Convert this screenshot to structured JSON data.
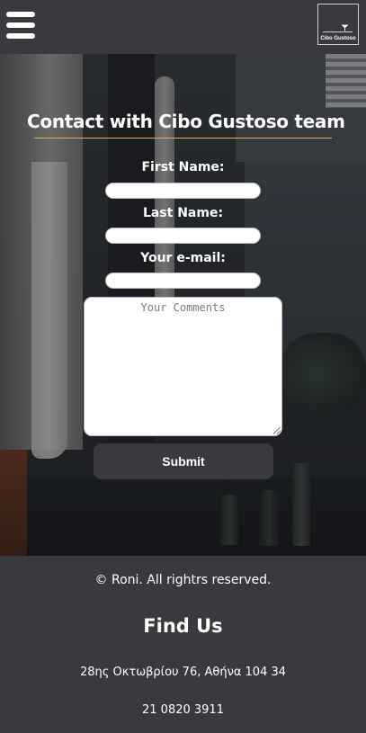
{
  "header": {
    "menu_icon": "hamburger-menu-icon",
    "logo": {
      "text": "Cibo Gustoso",
      "icon": "cocktail-glass-icon"
    }
  },
  "contact_form": {
    "title": "Contact with Cibo Gustoso team",
    "accent_color": "#d8b640",
    "first_name": {
      "label": "First Name:",
      "value": ""
    },
    "last_name": {
      "label": "Last Name:",
      "value": ""
    },
    "email": {
      "label": "Your e-mail:",
      "value": ""
    },
    "comments": {
      "placeholder": "Your Comments",
      "value": ""
    },
    "submit_label": "Submit"
  },
  "footer": {
    "copyright": "© Roni. All rightrs reserved.",
    "find_us_heading": "Find Us",
    "address": "28ης Οκτωβρίου 76, Αθήνα 104 34",
    "phone": "21 0820 3911"
  }
}
